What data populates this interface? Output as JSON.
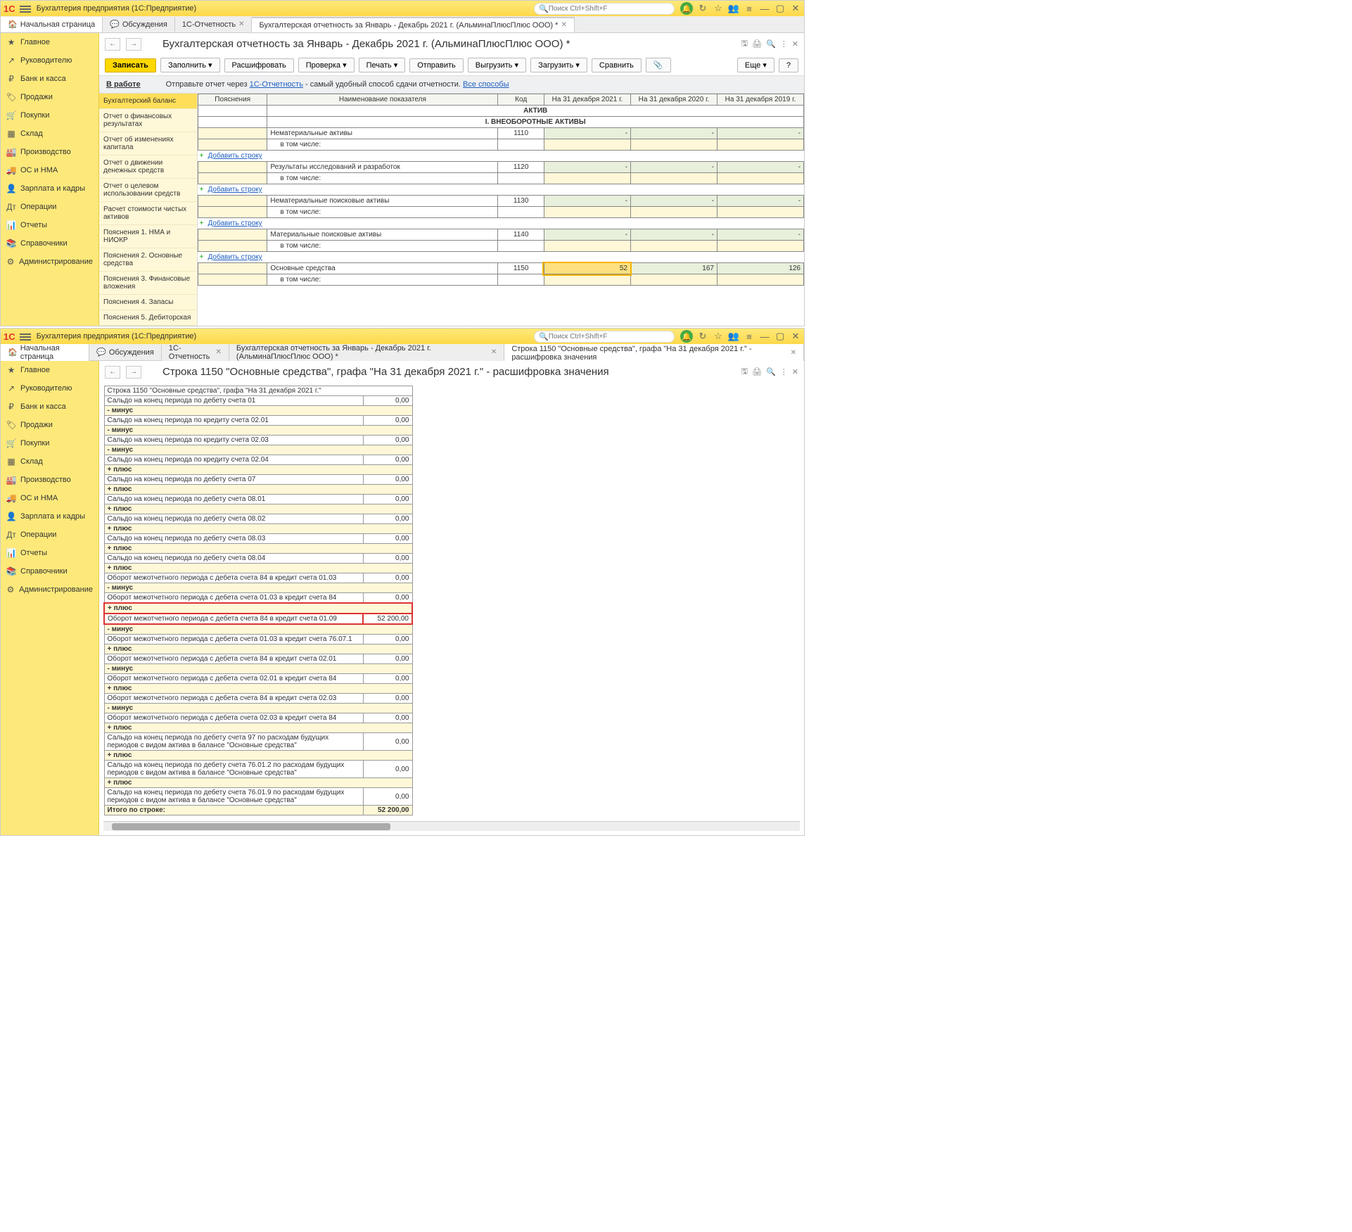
{
  "app": {
    "title": "Бухгалтерия предприятия  (1С:Предприятие)",
    "search_placeholder": "Поиск Ctrl+Shift+F"
  },
  "tabs_top": {
    "home": "Начальная страница",
    "t1": "Обсуждения",
    "t2": "1С-Отчетность",
    "t3": "Бухгалтерская отчетность за Январь - Декабрь 2021 г. (АльминаПлюсПлюс ООО) *"
  },
  "sidebar": {
    "items": [
      {
        "icon": "★",
        "label": "Главное"
      },
      {
        "icon": "↗",
        "label": "Руководителю"
      },
      {
        "icon": "₽",
        "label": "Банк и касса"
      },
      {
        "icon": "🏷",
        "label": "Продажи"
      },
      {
        "icon": "🛒",
        "label": "Покупки"
      },
      {
        "icon": "▦",
        "label": "Склад"
      },
      {
        "icon": "🏭",
        "label": "Производство"
      },
      {
        "icon": "🚚",
        "label": "ОС и НМА"
      },
      {
        "icon": "👤",
        "label": "Зарплата и кадры"
      },
      {
        "icon": "Дт",
        "label": "Операции"
      },
      {
        "icon": "📊",
        "label": "Отчеты"
      },
      {
        "icon": "📚",
        "label": "Справочники"
      },
      {
        "icon": "⚙",
        "label": "Администрирование"
      }
    ]
  },
  "page1": {
    "title": "Бухгалтерская отчетность за Январь - Декабрь 2021 г. (АльминаПлюсПлюс ООО) *",
    "buttons": {
      "save": "Записать",
      "fill": "Заполнить",
      "decode": "Расшифровать",
      "check": "Проверка",
      "print": "Печать",
      "send": "Отправить",
      "upload": "Выгрузить",
      "load": "Загрузить",
      "compare": "Сравнить",
      "more": "Еще",
      "help": "?"
    },
    "info": {
      "status": "В работе",
      "text1": "Отправьте отчет через ",
      "link1": "1С-Отчетность",
      "text2": " - самый удобный способ сдачи отчетности. ",
      "link2": "Все способы"
    },
    "tree": [
      "Бухгалтерский баланс",
      "Отчет о финансовых результатах",
      "Отчет об изменениях капитала",
      "Отчет о движении денежных средств",
      "Отчет о целевом использовании средств",
      "Расчет стоимости чистых активов",
      "Пояснения 1. НМА и НИОКР",
      "Пояснения 2. Основные средства",
      "Пояснения 3. Финансовые вложения",
      "Пояснения 4. Запасы",
      "Пояснения 5. Дебиторская"
    ],
    "grid": {
      "headers": {
        "p": "Пояснения",
        "n": "Наименование показателя",
        "c": "Код",
        "y1": "На 31 декабря 2021 г.",
        "y2": "На 31 декабря 2020 г.",
        "y3": "На 31 декабря 2019 г."
      },
      "section1": "АКТИВ",
      "section2": "I. ВНЕОБОРОТНЫЕ АКТИВЫ",
      "rows": [
        {
          "name": "Нематериальные активы",
          "code": "1110",
          "v1": "-",
          "v2": "-",
          "v3": "-"
        },
        {
          "name": "в том числе:",
          "sub": true
        },
        {
          "add": "Добавить строку"
        },
        {
          "name": "Результаты исследований и разработок",
          "code": "1120",
          "v1": "-",
          "v2": "-",
          "v3": "-"
        },
        {
          "name": "в том числе:",
          "sub": true
        },
        {
          "add": "Добавить строку"
        },
        {
          "name": "Нематериальные поисковые активы",
          "code": "1130",
          "v1": "-",
          "v2": "-",
          "v3": "-"
        },
        {
          "name": "в том числе:",
          "sub": true
        },
        {
          "add": "Добавить строку"
        },
        {
          "name": "Материальные поисковые активы",
          "code": "1140",
          "v1": "-",
          "v2": "-",
          "v3": "-"
        },
        {
          "name": "в том числе:",
          "sub": true
        },
        {
          "add": "Добавить строку"
        },
        {
          "name": "Основные средства",
          "code": "1150",
          "v1": "52",
          "v2": "167",
          "v3": "126",
          "hl": true
        },
        {
          "name": "в том числе:",
          "sub": true
        }
      ]
    }
  },
  "page2": {
    "tab": "Строка 1150 \"Основные средства\", графа \"На 31 декабря 2021 г.\" - расшифровка значения",
    "title": "Строка 1150 \"Основные средства\", графа \"На 31 декабря 2021 г.\" - расшифровка значения",
    "header_row": "Строка 1150 \"Основные средства\", графа \"На 31 декабря 2021 г.\"",
    "rows": [
      {
        "t": "Сальдо на конец периода по дебету счета 01",
        "a": "0,00"
      },
      {
        "op": "- минус"
      },
      {
        "t": "Сальдо на конец периода по кредиту счета 02.01",
        "a": "0,00"
      },
      {
        "op": "- минус"
      },
      {
        "t": "Сальдо на конец периода по кредиту счета 02.03",
        "a": "0,00"
      },
      {
        "op": "- минус"
      },
      {
        "t": "Сальдо на конец периода по кредиту счета 02.04",
        "a": "0,00"
      },
      {
        "op": "+ плюс"
      },
      {
        "t": "Сальдо на конец периода по дебету счета 07",
        "a": "0,00"
      },
      {
        "op": "+ плюс"
      },
      {
        "t": "Сальдо на конец периода по дебету счета 08.01",
        "a": "0,00"
      },
      {
        "op": "+ плюс"
      },
      {
        "t": "Сальдо на конец периода по дебету счета 08.02",
        "a": "0,00"
      },
      {
        "op": "+ плюс"
      },
      {
        "t": "Сальдо на конец периода по дебету счета 08.03",
        "a": "0,00"
      },
      {
        "op": "+ плюс"
      },
      {
        "t": "Сальдо на конец периода по дебету счета 08.04",
        "a": "0,00"
      },
      {
        "op": "+ плюс"
      },
      {
        "t": "Оборот межотчетного периода с дебета счета 84 в кредит счета 01.03",
        "a": "0,00"
      },
      {
        "op": "- минус"
      },
      {
        "t": "Оборот межотчетного периода с дебета счета 01.03 в кредит счета 84",
        "a": "0,00"
      },
      {
        "op": "+ плюс",
        "hl": true
      },
      {
        "t": "Оборот межотчетного периода с дебета счета 84 в кредит счета 01.09",
        "a": "52 200,00",
        "hl": true
      },
      {
        "op": "- минус"
      },
      {
        "t": "Оборот межотчетного периода с дебета счета 01.03 в кредит счета 76.07.1",
        "a": "0,00"
      },
      {
        "op": "+ плюс"
      },
      {
        "t": "Оборот межотчетного периода с дебета счета 84 в кредит счета 02.01",
        "a": "0,00"
      },
      {
        "op": "- минус"
      },
      {
        "t": "Оборот межотчетного периода с дебета счета 02.01 в кредит счета 84",
        "a": "0,00"
      },
      {
        "op": "+ плюс"
      },
      {
        "t": "Оборот межотчетного периода с дебета счета 84 в кредит счета 02.03",
        "a": "0,00"
      },
      {
        "op": "- минус"
      },
      {
        "t": "Оборот межотчетного периода с дебета счета 02.03 в кредит счета 84",
        "a": "0,00"
      },
      {
        "op": "+ плюс"
      },
      {
        "t": "Сальдо на конец периода по дебету счета 97 по расходам будущих периодов с видом актива в балансе \"Основные средства\"",
        "a": "0,00"
      },
      {
        "op": "+ плюс"
      },
      {
        "t": "Сальдо на конец периода по дебету счета 76.01.2 по расходам будущих периодов с видом актива в балансе \"Основные средства\"",
        "a": "0,00"
      },
      {
        "op": "+ плюс"
      },
      {
        "t": "Сальдо на конец периода по дебету счета 76.01.9 по расходам будущих периодов с видом актива в балансе \"Основные средства\"",
        "a": "0,00"
      }
    ],
    "total_label": "Итого по строке:",
    "total_value": "52 200,00"
  }
}
